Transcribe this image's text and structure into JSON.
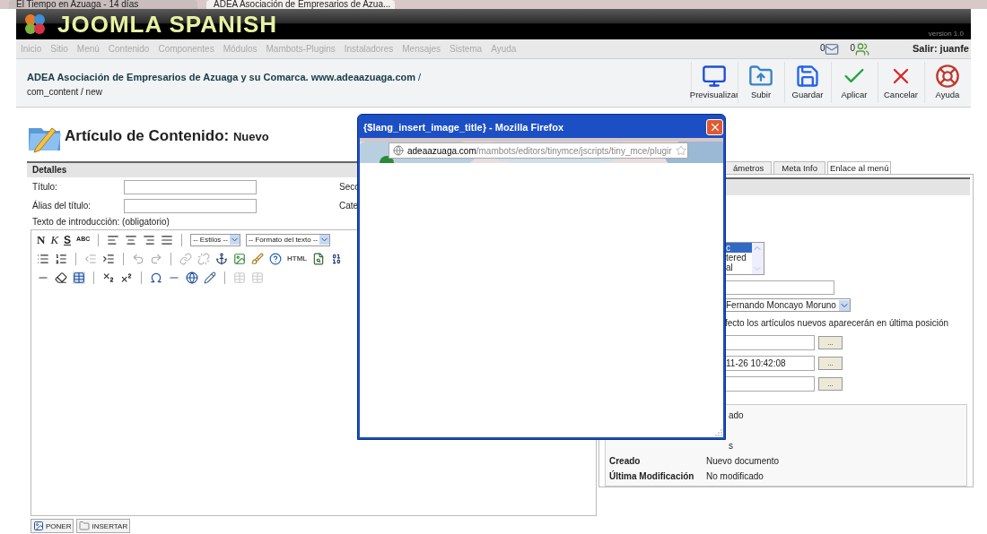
{
  "browser_tabs": [
    {
      "label": "El Tiempo en Azuaga - 14 días",
      "selected": false
    },
    {
      "label": "ADEA Asociación de Empresarios de Azua...",
      "selected": true
    }
  ],
  "header": {
    "logo_text": "JOOMLA SPANISH",
    "version": "version 1.0"
  },
  "menu": [
    {
      "label": "Inicio",
      "disabled": true
    },
    {
      "label": "Sitio",
      "disabled": true
    },
    {
      "label": "Menú",
      "disabled": true
    },
    {
      "label": "Contenido",
      "disabled": true
    },
    {
      "label": "Componentes",
      "disabled": true
    },
    {
      "label": "Módulos",
      "disabled": true
    },
    {
      "label": "Mambots-Plugins",
      "disabled": true
    },
    {
      "label": "Instaladores",
      "disabled": true
    },
    {
      "label": "Mensajes",
      "disabled": true
    },
    {
      "label": "Sistema",
      "disabled": true
    },
    {
      "label": "Ayuda",
      "disabled": true
    }
  ],
  "status": {
    "messages": "0",
    "users": "0",
    "logout": "Salir: juanfe"
  },
  "breadcrumb": {
    "site": "ADEA Asociación de Empresarios de Azuaga y su Comarca. www.adeaazuaga.com",
    "separator": "/",
    "path": "com_content / new"
  },
  "toolbar": [
    {
      "label": "Previsualizar"
    },
    {
      "label": "Subir"
    },
    {
      "label": "Guardar"
    },
    {
      "label": "Aplicar"
    },
    {
      "label": "Cancelar"
    },
    {
      "label": "Ayuda"
    }
  ],
  "page_title": {
    "title": "Artículo de Contenido:",
    "subtitle": "Nuevo"
  },
  "details": {
    "heading": "Detalles",
    "fields": [
      {
        "label": "Título:",
        "side_label": "Secc"
      },
      {
        "label": "Álias del título:",
        "side_label": "Cate"
      }
    ],
    "intro_label": "Texto de introducción: (obligatorio)"
  },
  "editor": {
    "format_buttons": [
      "N",
      "K",
      "S",
      "ABC"
    ],
    "styles_select": "-- Estilos --",
    "format_select": "-- Formato del texto --",
    "html_button": "HTML"
  },
  "bottom_buttons": [
    "PONER",
    "INSERTAR"
  ],
  "popup": {
    "title": "{$lang_insert_image_title} - Mozilla Firefox",
    "url_host": "adeaazuaga.com",
    "url_path": "/mambots/editors/tinymce/jscripts/tiny_mce/plugir"
  },
  "right_tabs": [
    {
      "label": "ámetros",
      "selected": false
    },
    {
      "label": "Meta Info",
      "selected": false
    },
    {
      "label": "Enlace al menú",
      "selected": true
    }
  ],
  "params": {
    "access_list": [
      {
        "label": "c",
        "selected": true
      },
      {
        "label": "tered",
        "selected": false
      },
      {
        "label": "al",
        "selected": false
      }
    ],
    "author": "Fernando Moncayo Moruno",
    "order_note": "fecto los artículos nuevos aparecerán en última posición",
    "dates": [
      {
        "button": "..."
      },
      {
        "value": "11-26 10:42:08",
        "button": "..."
      },
      {
        "button": "..."
      }
    ]
  },
  "info": [
    {
      "value": "ado"
    },
    {
      "value": "s"
    },
    {
      "label": "Creado",
      "value": "Nuevo documento"
    },
    {
      "label": "Última Modificación",
      "value": "No modificado"
    }
  ]
}
